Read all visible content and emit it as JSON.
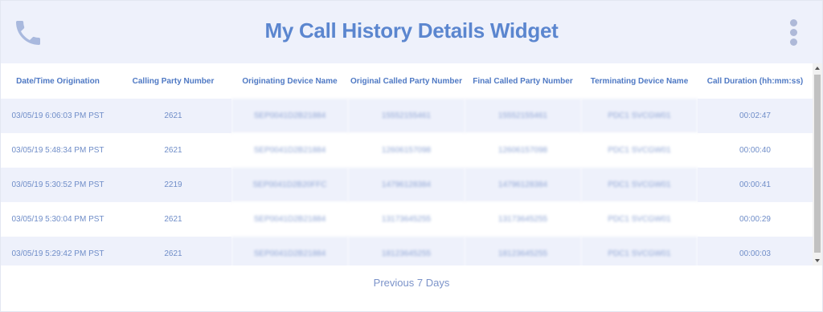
{
  "header": {
    "title": "My Call History Details Widget",
    "phone_icon": "phone-icon",
    "menu_icon": "more-vertical-icon"
  },
  "table": {
    "columns": [
      "Date/Time Origination",
      "Calling Party Number",
      "Originating Device Name",
      "Original Called Party Number",
      "Final Called Party Number",
      "Terminating Device Name",
      "Call Duration (hh:mm:ss)"
    ],
    "rows": [
      [
        "03/05/19 6:06:03 PM PST",
        "2621",
        "SEP0041D2B21884",
        "15552155461",
        "15552155461",
        "PDC1 SVCGW01",
        "00:02:47"
      ],
      [
        "03/05/19 5:48:34 PM PST",
        "2621",
        "SEP0041D2B21884",
        "12606157098",
        "12606157098",
        "PDC1 SVCGW01",
        "00:00:40"
      ],
      [
        "03/05/19 5:30:52 PM PST",
        "2219",
        "SEP0041D2B20FFC",
        "14796128384",
        "14796128384",
        "PDC1 SVCGW01",
        "00:00:41"
      ],
      [
        "03/05/19 5:30:04 PM PST",
        "2621",
        "SEP0041D2B21884",
        "13173645255",
        "13173645255",
        "PDC1 SVCGW01",
        "00:00:29"
      ],
      [
        "03/05/19 5:29:42 PM PST",
        "2621",
        "SEP0041D2B21884",
        "18123645255",
        "18123645255",
        "PDC1 SVCGW01",
        "00:00:03"
      ]
    ]
  },
  "footer": {
    "link_label": "Previous 7 Days"
  },
  "colors": {
    "accent": "#5b86cf",
    "header_bg": "#eef1fb",
    "row_alt_bg": "#eef1fb"
  }
}
